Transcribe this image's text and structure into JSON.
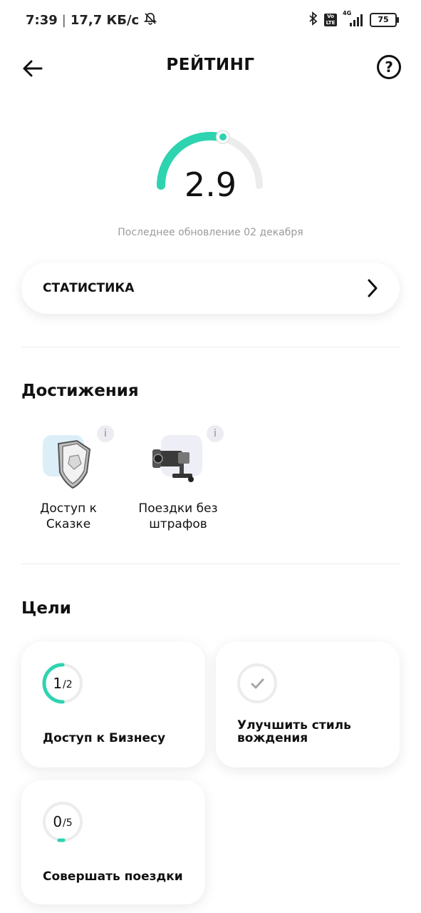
{
  "status": {
    "time": "7:39",
    "speed": "17,7 КБ/с",
    "battery": "75",
    "network": "4G"
  },
  "header": {
    "title": "РЕЙТИНГ",
    "back_icon": "arrow-left-icon",
    "help_icon": "question-circle-icon"
  },
  "rating": {
    "value": "2.9",
    "update_text": "Последнее обновление 02 декабря",
    "accent_color": "#2ed3b0"
  },
  "stats": {
    "label": "СТАТИСТИКА"
  },
  "achievements": {
    "title": "Достижения",
    "items": [
      {
        "label_line1": "Доступ к",
        "label_line2": "Сказке",
        "icon": "shield-icon",
        "info": "i"
      },
      {
        "label_line1": "Поездки без",
        "label_line2": "штрафов",
        "icon": "security-camera-icon",
        "info": "i"
      }
    ]
  },
  "goals": {
    "title": "Цели",
    "items": [
      {
        "done": "1",
        "total": "/2",
        "progress": 0.5,
        "label": "Доступ к Бизнесу"
      },
      {
        "icon": "check-icon",
        "label_line1": "Улучшить стиль",
        "label_line2": "вождения"
      },
      {
        "done": "0",
        "total": "/5",
        "progress": 0.05,
        "label": "Совершать поездки"
      }
    ]
  }
}
